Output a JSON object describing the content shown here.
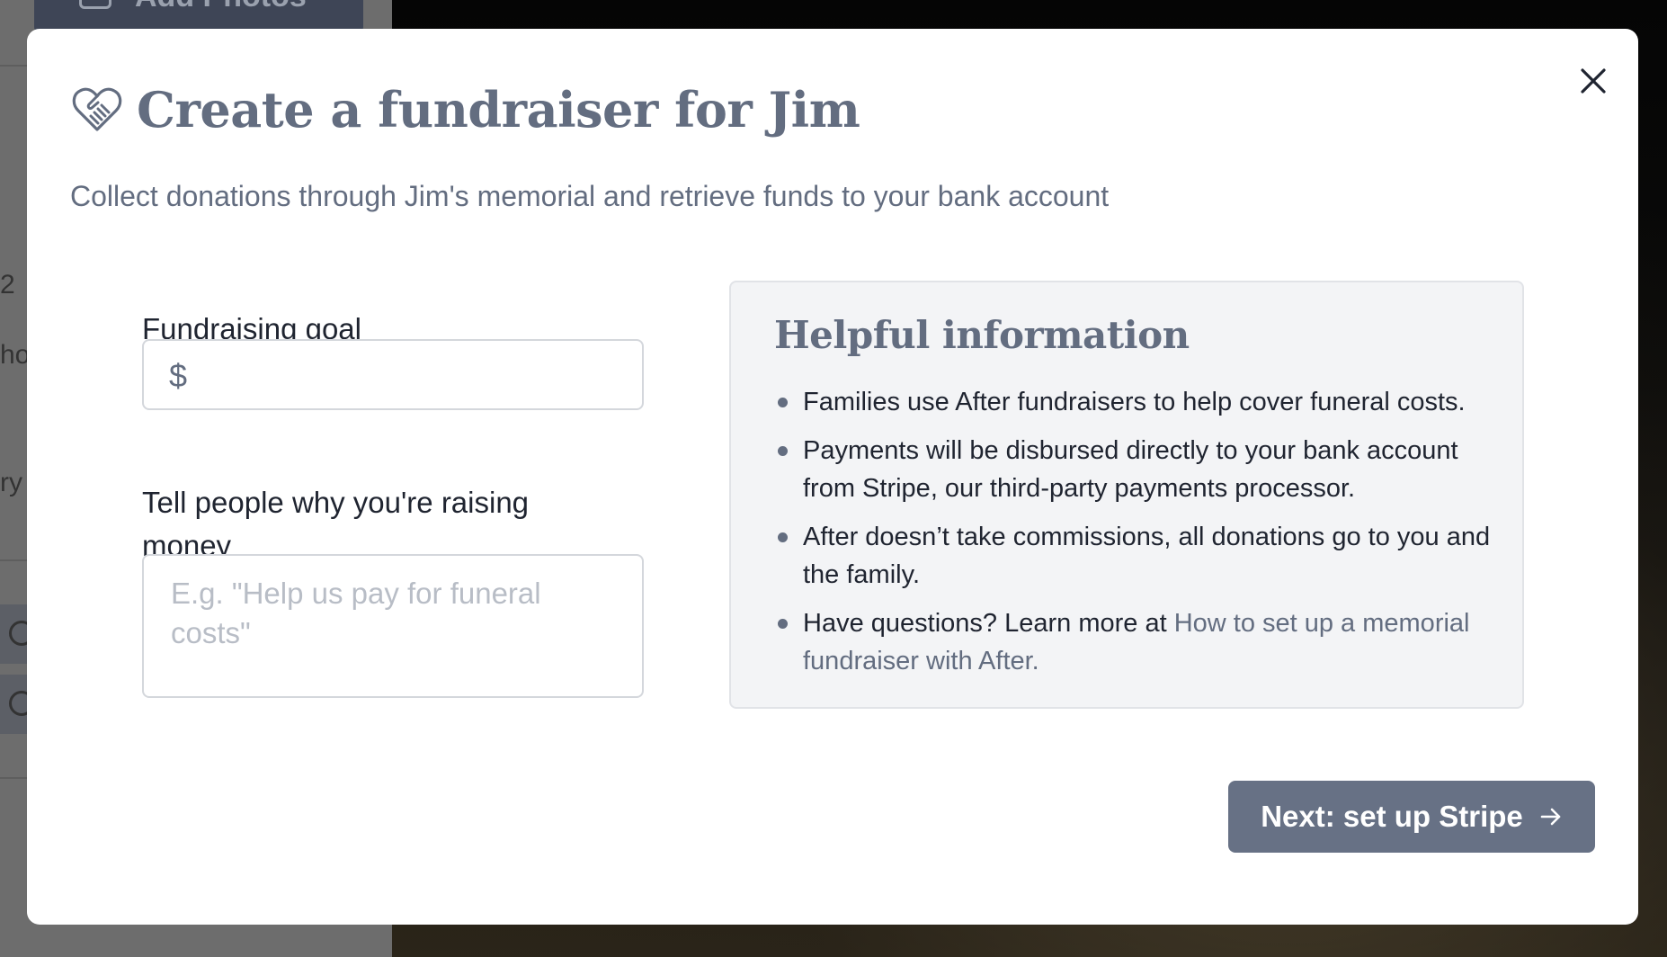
{
  "background": {
    "add_photos_label": "Add Photos",
    "fragment_1": "2",
    "fragment_2": "ho",
    "fragment_3": "ry"
  },
  "modal": {
    "title": "Create a fundraiser for Jim",
    "subtitle": "Collect donations through Jim's memorial and retrieve funds to your bank account",
    "close_icon": "close-icon",
    "title_icon": "heart-handshake-icon"
  },
  "form": {
    "goal_label": "Fundraising goal",
    "goal_prefix": "$",
    "goal_value": "",
    "why_label": "Tell people why you're raising money",
    "why_placeholder": "E.g. \"Help us pay for funeral costs\"",
    "why_value": ""
  },
  "info": {
    "title": "Helpful information",
    "items": [
      "Families use After fundraisers to help cover funeral costs.",
      "Payments will be disbursed directly to your bank account from Stripe, our third-party payments processor.",
      "After doesn’t take commissions, all donations go to you and the family.",
      "Have questions? Learn more at "
    ],
    "link_text": "How to set up a memorial fundraiser with After."
  },
  "actions": {
    "next_label": "Next: set up Stripe",
    "next_icon": "arrow-right-icon"
  },
  "colors": {
    "accent": "#636d80",
    "button": "#677185",
    "panel_bg": "#f3f4f6",
    "border": "#d4d7dc"
  }
}
